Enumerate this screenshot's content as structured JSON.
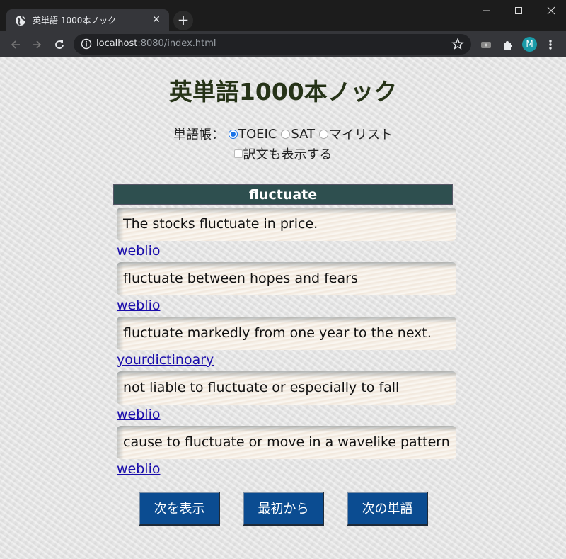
{
  "browser": {
    "tab_title": "英単語 1000本ノック",
    "tab_favicon": "globe-icon",
    "new_tab_label": "+",
    "url_host": "localhost",
    "url_rest": ":8080/index.html",
    "avatar_initial": "M",
    "avatar_color": "#1a9aa8",
    "icons": [
      "back-icon",
      "forward-icon",
      "reload-icon",
      "info-icon",
      "star-icon",
      "cast-icon",
      "puzzle-icon",
      "more-vert-icon",
      "minimize-icon",
      "maximize-icon",
      "close-icon"
    ]
  },
  "page": {
    "title": "英単語1000本ノック",
    "wordbook_label": "単語帳：",
    "wordbooks": [
      {
        "label": "TOEIC",
        "checked": true
      },
      {
        "label": "SAT",
        "checked": false
      },
      {
        "label": "マイリスト",
        "checked": false
      }
    ],
    "show_translation_label": "訳文も表示する",
    "show_translation_checked": false,
    "word": "fluctuate",
    "header_color": "#2e4f4f",
    "entries": [
      {
        "sentence": "The stocks fluctuate in price.",
        "source": "weblio"
      },
      {
        "sentence": "fluctuate between hopes and fears",
        "source": "weblio"
      },
      {
        "sentence": "fluctuate markedly from one year to the next.",
        "source": "yourdictinoary"
      },
      {
        "sentence": "not liable to fluctuate or especially to fall",
        "source": "weblio"
      },
      {
        "sentence": "cause to fluctuate or move in a wavelike pattern",
        "source": "weblio"
      }
    ],
    "buttons": {
      "show_next": "次を表示",
      "restart": "最初から",
      "next_word": "次の単語"
    },
    "button_color": "#0b4c91"
  }
}
